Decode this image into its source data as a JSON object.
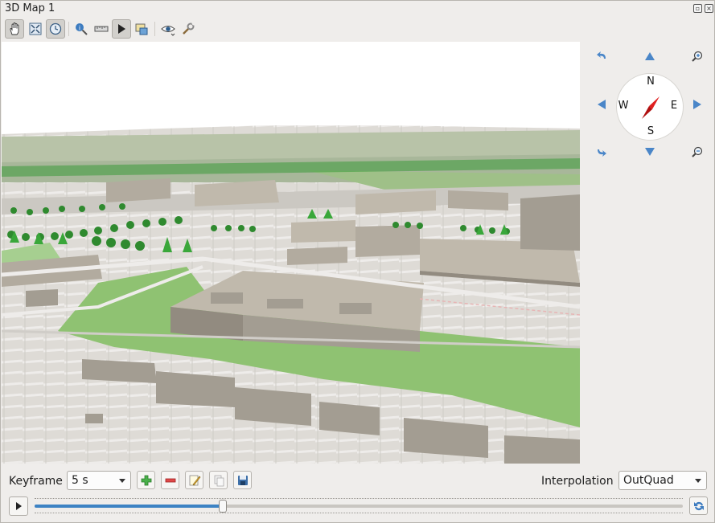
{
  "window": {
    "title": "3D Map 1"
  },
  "toolbar": {
    "tools": [
      {
        "icon": "pan-hand-icon"
      },
      {
        "icon": "zoom-full-icon"
      },
      {
        "icon": "camera-control-icon"
      },
      {
        "icon": "identify-icon"
      },
      {
        "icon": "measure-line-icon"
      },
      {
        "icon": "animation-play-icon"
      },
      {
        "icon": "export-scene-icon"
      },
      {
        "icon": "camera-view-icon"
      },
      {
        "icon": "options-wrench-icon"
      }
    ]
  },
  "navigation": {
    "compass": {
      "n": "N",
      "s": "S",
      "e": "E",
      "w": "W"
    },
    "colors": {
      "accent": "#4a86c8",
      "needle": "#e02020"
    }
  },
  "keyframes": {
    "label": "Keyframe",
    "selected": "5 s",
    "interpolation_label": "Interpolation",
    "interpolation_value": "OutQuad"
  },
  "timeline": {
    "position": 0.29
  }
}
